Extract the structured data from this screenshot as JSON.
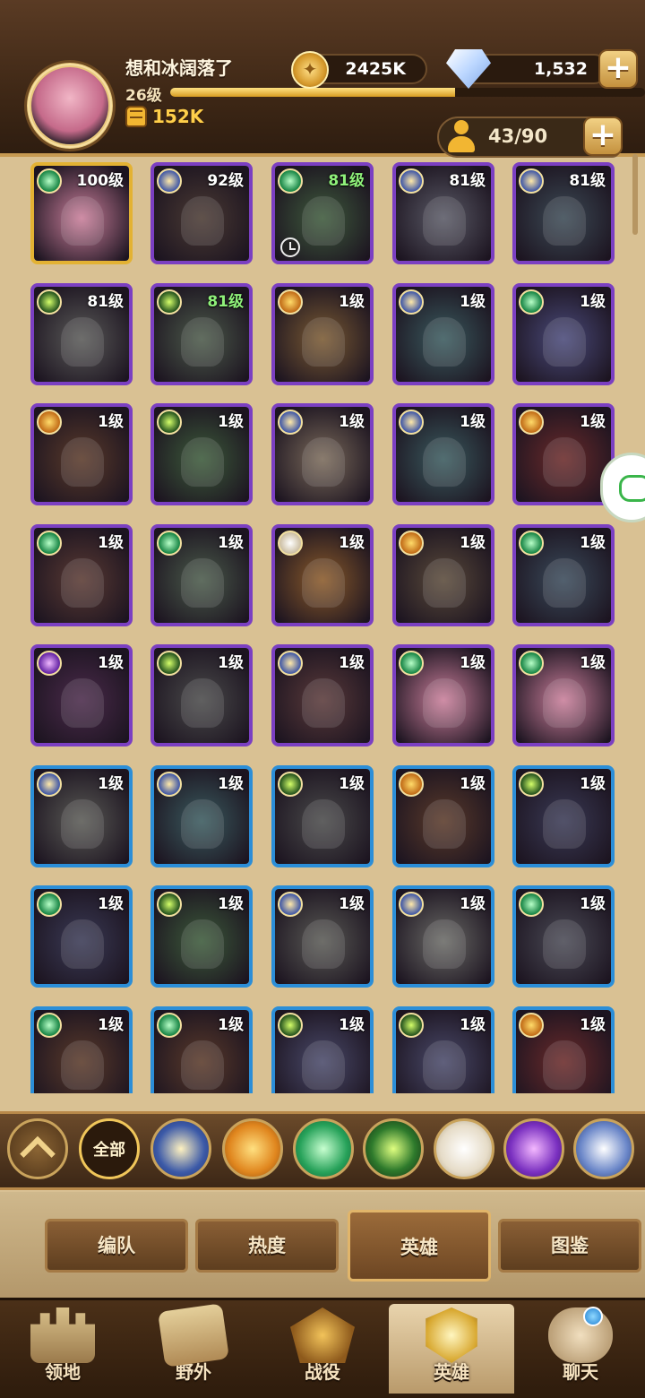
{
  "player": {
    "name": "想和冰阔落了",
    "level": "26级",
    "power": "152K",
    "xp_fraction": 0.6
  },
  "resources": {
    "gold": "2425K",
    "gems": "1,532",
    "plus": "+"
  },
  "roster": {
    "count": "43/90",
    "plus": "+"
  },
  "heroes": [
    {
      "level": "100级",
      "faction": "wilder",
      "frame": "gold-frame",
      "bg": "#c97e9a",
      "green": false
    },
    {
      "level": "92级",
      "faction": "lightbearer",
      "frame": "purple",
      "bg": "#4a3a33",
      "green": false
    },
    {
      "level": "81级",
      "faction": "wilder",
      "frame": "purple",
      "bg": "#3e5a3c",
      "green": true,
      "clock": true
    },
    {
      "level": "81级",
      "faction": "lightbearer",
      "frame": "purple",
      "bg": "#5a5a66",
      "green": false
    },
    {
      "level": "81级",
      "faction": "lightbearer",
      "frame": "purple",
      "bg": "#3c4a55",
      "green": false
    },
    {
      "level": "81级",
      "faction": "graveborn",
      "frame": "purple",
      "bg": "#5a5a58",
      "green": false
    },
    {
      "level": "81级",
      "faction": "graveborn",
      "frame": "purple",
      "bg": "#4c5a4a",
      "green": true
    },
    {
      "level": "1级",
      "faction": "mauler",
      "frame": "purple",
      "bg": "#7a5a33",
      "green": false
    },
    {
      "level": "1级",
      "faction": "lightbearer",
      "frame": "purple",
      "bg": "#3a5a5e",
      "green": false
    },
    {
      "level": "1级",
      "faction": "wilder",
      "frame": "purple",
      "bg": "#4a4a7a",
      "green": false
    },
    {
      "level": "1级",
      "faction": "mauler",
      "frame": "purple",
      "bg": "#5a3a2a",
      "green": false
    },
    {
      "level": "1级",
      "faction": "graveborn",
      "frame": "purple",
      "bg": "#3c5a3a",
      "green": false
    },
    {
      "level": "1级",
      "faction": "lightbearer",
      "frame": "purple",
      "bg": "#7a6a5a",
      "green": false
    },
    {
      "level": "1级",
      "faction": "lightbearer",
      "frame": "purple",
      "bg": "#3a5a5e",
      "green": false
    },
    {
      "level": "1级",
      "faction": "mauler",
      "frame": "purple",
      "bg": "#6a2a2a",
      "green": false
    },
    {
      "level": "1级",
      "faction": "wilder",
      "frame": "purple",
      "bg": "#5a3a33",
      "green": false
    },
    {
      "level": "1级",
      "faction": "wilder",
      "frame": "purple",
      "bg": "#4a5a4a",
      "green": false
    },
    {
      "level": "1级",
      "faction": "celestial",
      "frame": "purple",
      "bg": "#8a5a2a",
      "green": false
    },
    {
      "level": "1级",
      "faction": "mauler",
      "frame": "purple",
      "bg": "#5a4a3a",
      "green": false
    },
    {
      "level": "1级",
      "faction": "wilder",
      "frame": "purple",
      "bg": "#3a4a5a",
      "green": false
    },
    {
      "level": "1级",
      "faction": "hypogean",
      "frame": "purple",
      "bg": "#4a2a4a",
      "green": false
    },
    {
      "level": "1级",
      "faction": "graveborn",
      "frame": "purple",
      "bg": "#4a4a4a",
      "green": false
    },
    {
      "level": "1级",
      "faction": "lightbearer",
      "frame": "purple",
      "bg": "#5a3a3a",
      "green": false
    },
    {
      "level": "1级",
      "faction": "wilder",
      "frame": "purple",
      "bg": "#c97e9a",
      "green": false
    },
    {
      "level": "1级",
      "faction": "wilder",
      "frame": "purple",
      "bg": "#c97e9a",
      "green": false
    },
    {
      "level": "1级",
      "faction": "lightbearer",
      "frame": "blue",
      "bg": "#5a5a55",
      "green": false
    },
    {
      "level": "1级",
      "faction": "lightbearer",
      "frame": "blue",
      "bg": "#3a5a5e",
      "green": false
    },
    {
      "level": "1级",
      "faction": "graveborn",
      "frame": "blue",
      "bg": "#4a4a4a",
      "green": false
    },
    {
      "level": "1级",
      "faction": "mauler",
      "frame": "blue",
      "bg": "#5a3a2a",
      "green": false
    },
    {
      "level": "1级",
      "faction": "graveborn",
      "frame": "blue",
      "bg": "#3a3a55",
      "green": false
    },
    {
      "level": "1级",
      "faction": "wilder",
      "frame": "blue",
      "bg": "#3a3a55",
      "green": false
    },
    {
      "level": "1级",
      "faction": "graveborn",
      "frame": "blue",
      "bg": "#3c5a3a",
      "green": false
    },
    {
      "level": "1级",
      "faction": "lightbearer",
      "frame": "blue",
      "bg": "#5a5a55",
      "green": false
    },
    {
      "level": "1级",
      "faction": "lightbearer",
      "frame": "blue",
      "bg": "#6a6a66",
      "green": false
    },
    {
      "level": "1级",
      "faction": "wilder",
      "frame": "blue",
      "bg": "#4a4a55",
      "green": false
    },
    {
      "level": "1级",
      "faction": "wilder",
      "frame": "blue",
      "bg": "#5a3a2a",
      "green": false
    },
    {
      "level": "1级",
      "faction": "wilder",
      "frame": "blue",
      "bg": "#5a3a2a",
      "green": false
    },
    {
      "level": "1级",
      "faction": "graveborn",
      "frame": "blue",
      "bg": "#4a4a6a",
      "green": false
    },
    {
      "level": "1级",
      "faction": "graveborn",
      "frame": "blue",
      "bg": "#4a4a6a",
      "green": false
    },
    {
      "level": "1级",
      "faction": "mauler",
      "frame": "blue",
      "bg": "#6a2a2a",
      "green": false
    }
  ],
  "filters": [
    {
      "name": "expand-up",
      "label": "",
      "cls": "f-up"
    },
    {
      "name": "all",
      "label": "全部",
      "cls": "f-all"
    },
    {
      "name": "lightbearer",
      "label": "",
      "cls": "f-light"
    },
    {
      "name": "mauler",
      "label": "",
      "cls": "f-maul"
    },
    {
      "name": "wilder",
      "label": "",
      "cls": "f-wild"
    },
    {
      "name": "graveborn",
      "label": "",
      "cls": "f-grave"
    },
    {
      "name": "celestial",
      "label": "",
      "cls": "f-cel"
    },
    {
      "name": "hypogean",
      "label": "",
      "cls": "f-hypo"
    },
    {
      "name": "dimensional",
      "label": "",
      "cls": "f-dim"
    }
  ],
  "subtabs": [
    {
      "label": "编队",
      "active": false
    },
    {
      "label": "热度",
      "active": false
    },
    {
      "label": "英雄",
      "active": true
    },
    {
      "label": "图鉴",
      "active": false
    }
  ],
  "nav": [
    {
      "label": "领地",
      "icon": "i-castle",
      "active": false
    },
    {
      "label": "野外",
      "icon": "i-map",
      "active": false
    },
    {
      "label": "战役",
      "icon": "i-battle",
      "active": false
    },
    {
      "label": "英雄",
      "icon": "i-hero",
      "active": true
    },
    {
      "label": "聊天",
      "icon": "i-chat",
      "active": false
    }
  ]
}
